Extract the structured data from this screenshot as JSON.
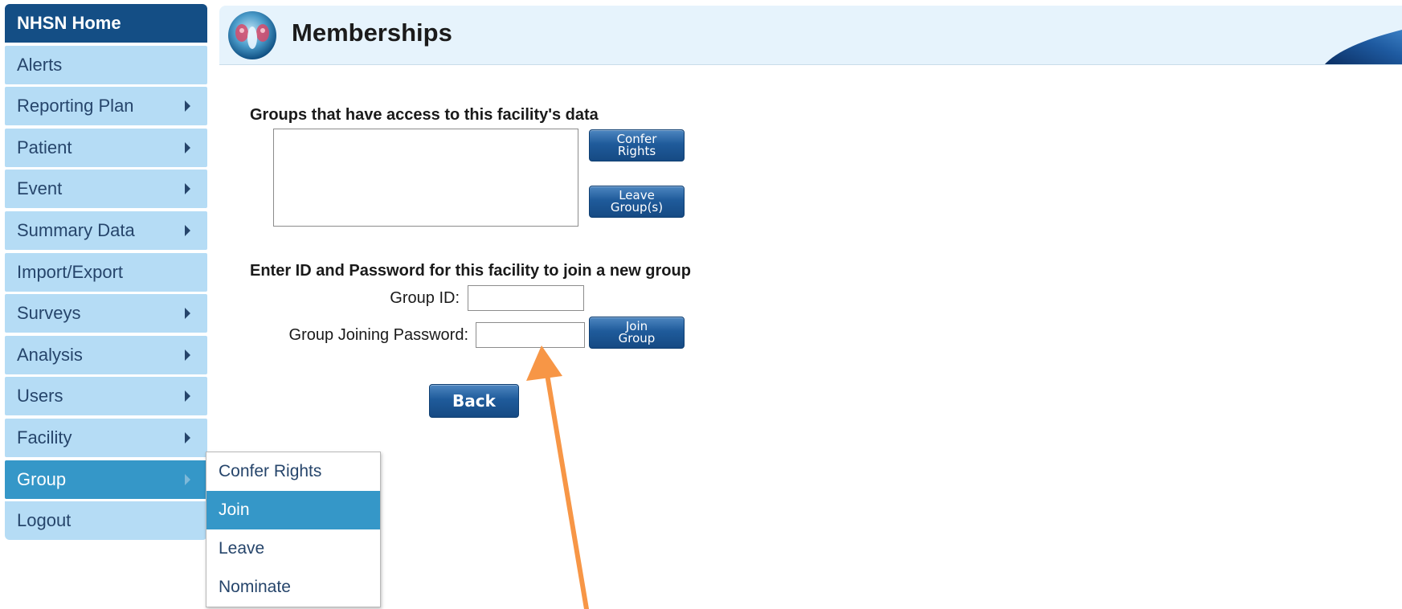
{
  "sidebar": {
    "items": [
      {
        "label": "NHSN Home"
      },
      {
        "label": "Alerts"
      },
      {
        "label": "Reporting Plan"
      },
      {
        "label": "Patient"
      },
      {
        "label": "Event"
      },
      {
        "label": "Summary Data"
      },
      {
        "label": "Import/Export"
      },
      {
        "label": "Surveys"
      },
      {
        "label": "Analysis"
      },
      {
        "label": "Users"
      },
      {
        "label": "Facility"
      },
      {
        "label": "Group"
      },
      {
        "label": "Logout"
      }
    ]
  },
  "group_submenu": {
    "items": [
      {
        "label": "Confer Rights"
      },
      {
        "label": "Join"
      },
      {
        "label": "Leave"
      },
      {
        "label": "Nominate"
      }
    ]
  },
  "header": {
    "title": "Memberships"
  },
  "groups_section": {
    "label": "Groups that have access to this facility's data",
    "confer_button": "Confer\nRights",
    "leave_button": "Leave\nGroup(s)"
  },
  "join_section": {
    "label": "Enter ID and Password for this facility to join a new group",
    "group_id_label": "Group ID:",
    "group_id_value": "",
    "password_label": "Group Joining Password:",
    "password_value": "",
    "join_button": "Join\nGroup"
  },
  "back_button": "Back",
  "colors": {
    "sidebar_bg": "#b5dcf5",
    "home_bg": "#144e85",
    "active_bg": "#3597c8",
    "header_bg": "#e6f3fc",
    "button_bg": "#1f5b9b",
    "arrow": "#f79646"
  }
}
